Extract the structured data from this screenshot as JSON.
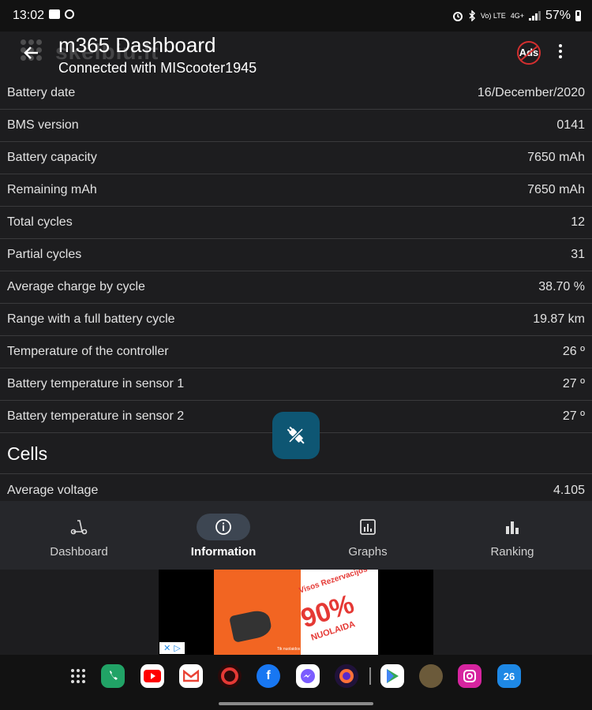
{
  "status_bar": {
    "time": "13:02",
    "network_label": "Vo) LTE",
    "network_label2": "4G+",
    "battery_percent": "57%"
  },
  "app_bar": {
    "title": "m365 Dashboard",
    "subtitle": "Connected with MIScooter1945",
    "ads_badge": "Ads",
    "watermark": "skelbiu.lt"
  },
  "rows": [
    {
      "label": "Battery date",
      "value": "16/December/2020"
    },
    {
      "label": "BMS version",
      "value": "0141"
    },
    {
      "label": "Battery capacity",
      "value": "7650 mAh"
    },
    {
      "label": "Remaining mAh",
      "value": "7650 mAh"
    },
    {
      "label": "Total cycles",
      "value": "12"
    },
    {
      "label": "Partial cycles",
      "value": "31"
    },
    {
      "label": "Average charge by cycle",
      "value": "38.70 %"
    },
    {
      "label": "Range with a full battery cycle",
      "value": "19.87 km"
    },
    {
      "label": "Temperature of the controller",
      "value": "26 º"
    },
    {
      "label": "Battery temperature in sensor 1",
      "value": "27 º"
    },
    {
      "label": "Battery temperature in sensor 2",
      "value": "27 º"
    }
  ],
  "cells_section": {
    "title": "Cells",
    "rows": [
      {
        "label": "Average voltage",
        "value": "4.105"
      }
    ]
  },
  "bottom_nav": {
    "items": [
      {
        "label": "Dashboard",
        "icon": "scooter-icon",
        "active": false
      },
      {
        "label": "Information",
        "icon": "info-icon",
        "active": true
      },
      {
        "label": "Graphs",
        "icon": "bar-chart-icon",
        "active": false
      },
      {
        "label": "Ranking",
        "icon": "ranking-icon",
        "active": false
      }
    ]
  },
  "ad": {
    "headline": "Visos Rezervacijos",
    "percent": "90%",
    "subline": "NUOLAIDA",
    "fine_print": "Tik nuolaidos programėlėje rezervuojant"
  },
  "dock": {
    "apps": [
      "apps-grid-icon",
      "phone-icon",
      "youtube-icon",
      "gmail-icon",
      "app-red-icon",
      "facebook-icon",
      "messenger-icon",
      "firefox-icon",
      "play-store-icon",
      "photo-app-icon",
      "instagram-icon",
      "calendar-icon"
    ],
    "calendar_day": "26"
  },
  "colors": {
    "background": "#1d1d1f",
    "fab": "#0e5673",
    "nav_active_pill": "#3d4652",
    "ad_orange": "#f26522"
  }
}
